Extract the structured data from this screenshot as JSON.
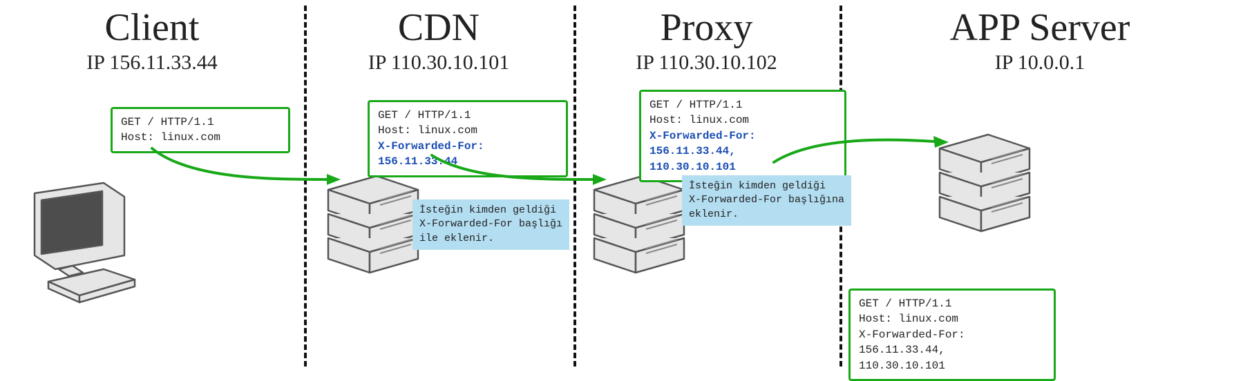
{
  "columns": {
    "client": {
      "title": "Client",
      "ip": "IP 156.11.33.44"
    },
    "cdn": {
      "title": "CDN",
      "ip": "IP 110.30.10.101"
    },
    "proxy": {
      "title": "Proxy",
      "ip": "IP 110.30.10.102"
    },
    "app": {
      "title": "APP Server",
      "ip": "IP 10.0.0.1"
    }
  },
  "requests": {
    "client": {
      "line1": "GET /  HTTP/1.1",
      "line2": "Host: linux.com"
    },
    "cdn": {
      "line1": "GET /  HTTP/1.1",
      "line2": "Host: linux.com",
      "xff": "X-Forwarded-For: 156.11.33.44"
    },
    "proxy": {
      "line1": "GET /  HTTP/1.1",
      "line2": "Host: linux.com",
      "xff_a": "X-Forwarded-For: 156.11.33.44,",
      "xff_b": "110.30.10.101"
    },
    "app": {
      "line1": "GET /  HTTP/1.1",
      "line2": "Host: linux.com",
      "line3": "X-Forwarded-For: 156.11.33.44,",
      "line4": "110.30.10.101"
    }
  },
  "notes": {
    "cdn": "İsteğin kimden geldiği\nX-Forwarded-For başlığı\nile eklenir.",
    "proxy": "İsteğin kimden geldiği\nX-Forwarded-For başlığına\neklenir."
  }
}
